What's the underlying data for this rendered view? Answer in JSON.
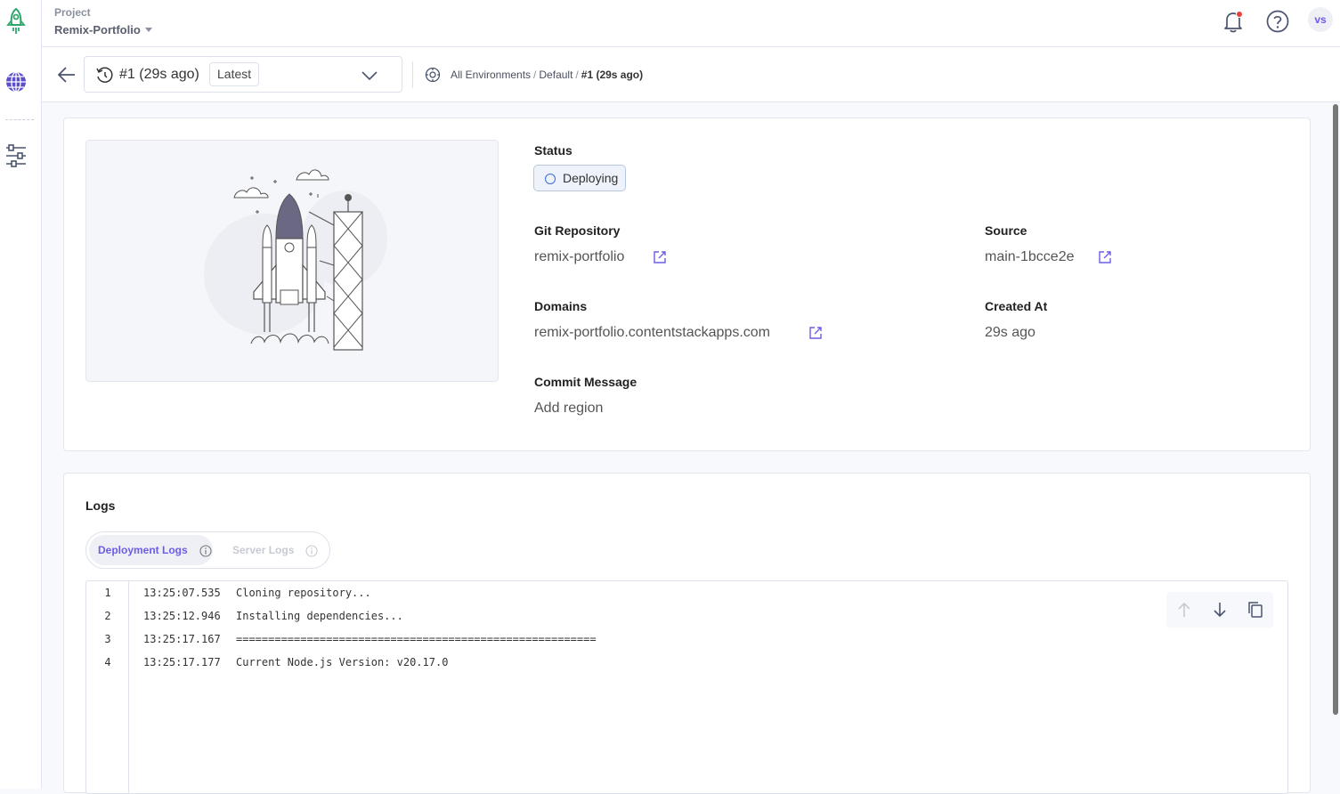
{
  "header": {
    "project_label": "Project",
    "project_name": "Remix-Portfolio",
    "avatar_initials": "vs"
  },
  "subheader": {
    "deployment_label": "#1 (29s ago)",
    "latest_badge": "Latest",
    "breadcrumb": [
      "All Environments",
      "Default",
      "#1 (29s ago)"
    ],
    "separator": "/"
  },
  "details": {
    "status_label": "Status",
    "status_value": "Deploying",
    "git_label": "Git Repository",
    "git_value": "remix-portfolio",
    "source_label": "Source",
    "source_value": "main-1bcce2e",
    "domains_label": "Domains",
    "domains_value": "remix-portfolio.contentstackapps.com",
    "created_label": "Created At",
    "created_value": "29s ago",
    "commit_label": "Commit Message",
    "commit_value": "Add region"
  },
  "logs": {
    "title": "Logs",
    "tabs": [
      "Deployment Logs",
      "Server Logs"
    ],
    "lines": [
      {
        "n": "1",
        "time": "13:25:07.535",
        "text": "Cloning repository..."
      },
      {
        "n": "2",
        "time": "13:25:12.946",
        "text": "Installing dependencies..."
      },
      {
        "n": "3",
        "time": "13:25:17.167",
        "text": "========================================================"
      },
      {
        "n": "4",
        "time": "13:25:17.177",
        "text": "Current Node.js Version: v20.17.0"
      }
    ]
  },
  "colors": {
    "accent": "#6c5ce7",
    "status_ring": "#3f6ad8",
    "notification_dot": "#e8413b"
  }
}
